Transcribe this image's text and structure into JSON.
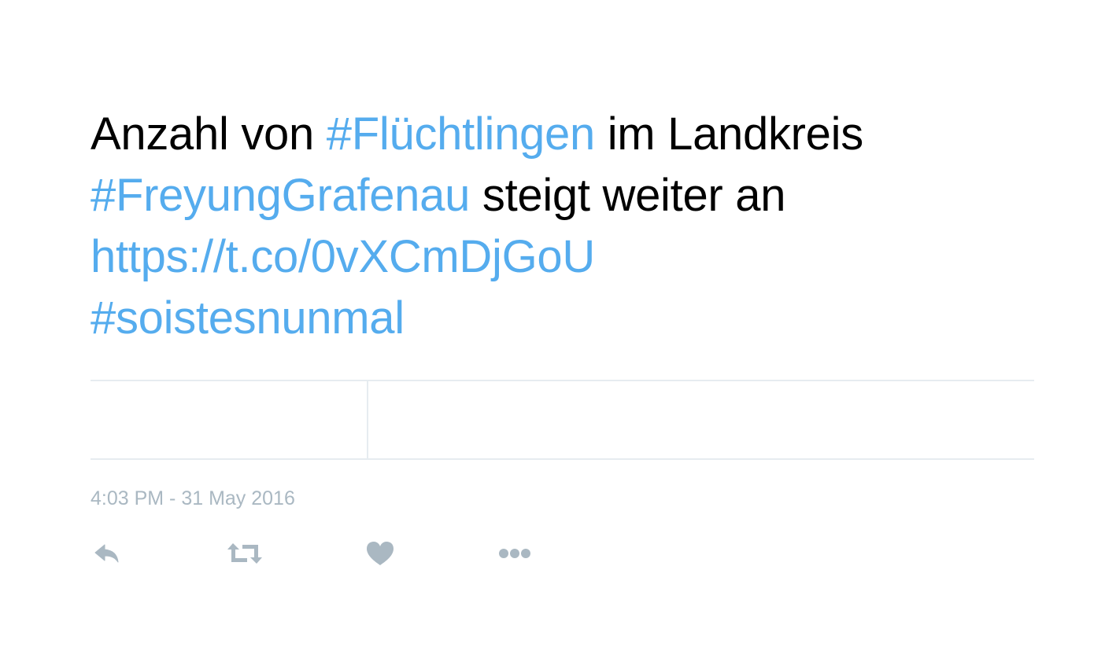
{
  "tweet": {
    "text_lines": [
      {
        "part1": "Anzahl von ",
        "hashtag1": "#Flüchtlingen",
        "part2": " im Landkreis"
      },
      {
        "hashtag2": "#FreyungGrafenau",
        "part3": " steigt weiter an"
      },
      {
        "url": "https://t.co/0vXCmDjGoU"
      },
      {
        "hashtag3": "#soistesnunmal"
      }
    ],
    "timestamp": "4:03 PM - 31 May 2016"
  },
  "actions": [
    {
      "name": "reply",
      "icon": "reply-icon"
    },
    {
      "name": "retweet",
      "icon": "retweet-icon"
    },
    {
      "name": "like",
      "icon": "heart-icon"
    },
    {
      "name": "more",
      "icon": "more-icon"
    }
  ],
  "colors": {
    "text": "#000000",
    "link": "#55acee",
    "muted": "#aab8c2",
    "divider": "#e6ecf0"
  }
}
